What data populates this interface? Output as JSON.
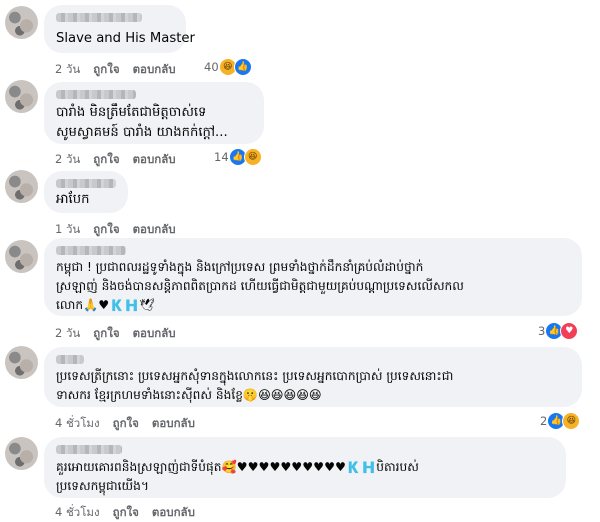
{
  "actions": {
    "like": "ถูกใจ",
    "reply": "ตอบกลับ"
  },
  "comments": [
    {
      "text": [
        "Slave and His Master"
      ],
      "time": "2 วัน",
      "reaction_count": "40",
      "reactions": [
        "haha",
        "like"
      ]
    },
    {
      "text": [
        "បារាំង មិនត្រឹមតែជាមិត្តចាស់ទេ",
        "សូមស្វាគមន៍ បារាំង យាងកក់ក្តៅ..."
      ],
      "time": "2 วัน",
      "reaction_count": "14",
      "reactions": [
        "like",
        "haha"
      ]
    },
    {
      "text": [
        "អាបែក"
      ],
      "time": "1 วัน",
      "reaction_count": "",
      "reactions": []
    },
    {
      "text": [
        "កម្ពុជា ! ប្រជាពលរដ្ឋទូទាំងក្នុង និងក្រៅប្រទេស ព្រមទាំងថ្នាក់ដឹកនាំគ្រប់លំដាប់ថ្នាក់",
        "ស្រឡាញ់ និងចង់បានសន្តិភាពពិតប្រាកដ ហើយធ្វើជាមិត្តជាមួយគ្រប់បណ្តាប្រទេសលើសកល",
        "លោក🙏♥🇰🇭🕊"
      ],
      "time": "2 วัน",
      "reaction_count": "3",
      "reactions": [
        "like",
        "love"
      ]
    },
    {
      "text": [
        "ប្រទេសត្រីក្រនោះ ប្រទេសអ្នកសុំទានក្នុងលោកនេះ ប្រទេសអ្នកបោកប្រាស់ ប្រទេសនោះជា",
        "ទាសករ ខ្មែរក្រហមទាំងនោះស៊ីពស់ និងខ្លែ🤫😆😆😆😆😆"
      ],
      "time": "4 ชั่วโมง",
      "reaction_count": "2",
      "reactions": [
        "like",
        "haha"
      ]
    },
    {
      "text": [
        "គួរអោយគោរពនិងស្រឡាញ់ជាទីបំផុត🥰♥♥♥♥♥♥♥♥♥♥🇰🇭បិតារបស់",
        "ប្រទេសកម្ពុជាយើង។"
      ],
      "time": "4 ชั่วโมง",
      "reaction_count": "",
      "reactions": []
    }
  ]
}
